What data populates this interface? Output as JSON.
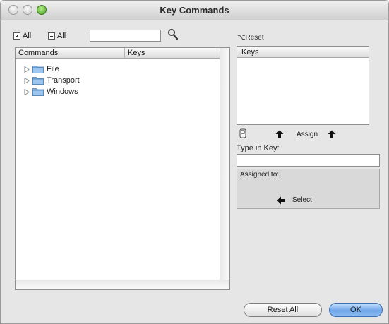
{
  "window": {
    "title": "Key Commands"
  },
  "toolbar": {
    "expand_all_label": "All",
    "collapse_all_label": "All",
    "search": {
      "value": "",
      "placeholder": ""
    }
  },
  "reset_label": "⌥Reset",
  "commands_panel": {
    "columns": [
      "Commands",
      "Keys"
    ],
    "items": [
      {
        "label": "File",
        "icon": "folder-icon"
      },
      {
        "label": "Transport",
        "icon": "folder-icon"
      },
      {
        "label": "Windows",
        "icon": "folder-icon"
      }
    ]
  },
  "keys_panel": {
    "header": "Keys"
  },
  "assign": {
    "label": "Assign"
  },
  "type_in_key": {
    "label": "Type in Key:",
    "value": ""
  },
  "assigned_to": {
    "label": "Assigned to:",
    "select_label": "Select"
  },
  "buttons": {
    "reset_all": "Reset All",
    "ok": "OK"
  },
  "colors": {
    "ok_button": "#6fa6e8",
    "zoom_button": "#3f9a1c"
  }
}
